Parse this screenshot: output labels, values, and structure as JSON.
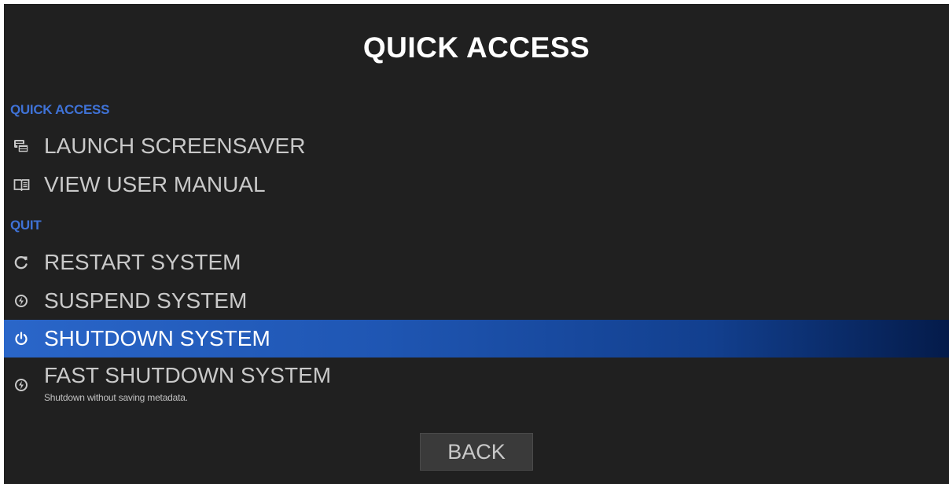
{
  "header": {
    "title": "QUICK ACCESS"
  },
  "sections": [
    {
      "label": "QUICK ACCESS",
      "items": [
        {
          "icon": "screensaver-icon",
          "label": "LAUNCH SCREENSAVER"
        },
        {
          "icon": "manual-book-icon",
          "label": "VIEW USER MANUAL"
        }
      ]
    },
    {
      "label": "QUIT",
      "items": [
        {
          "icon": "restart-icon",
          "label": "RESTART SYSTEM"
        },
        {
          "icon": "suspend-icon",
          "label": "SUSPEND SYSTEM"
        },
        {
          "icon": "power-icon",
          "label": "SHUTDOWN SYSTEM",
          "selected": true
        },
        {
          "icon": "fast-shutdown-icon",
          "label": "FAST SHUTDOWN SYSTEM",
          "description": "Shutdown without saving metadata."
        }
      ]
    }
  ],
  "footer": {
    "back_label": "BACK"
  },
  "colors": {
    "background": "#202020",
    "section_label": "#3f72d6",
    "selected_start": "#2a66c9",
    "selected_end": "#041b4a",
    "item_text": "#c9c9c9"
  }
}
